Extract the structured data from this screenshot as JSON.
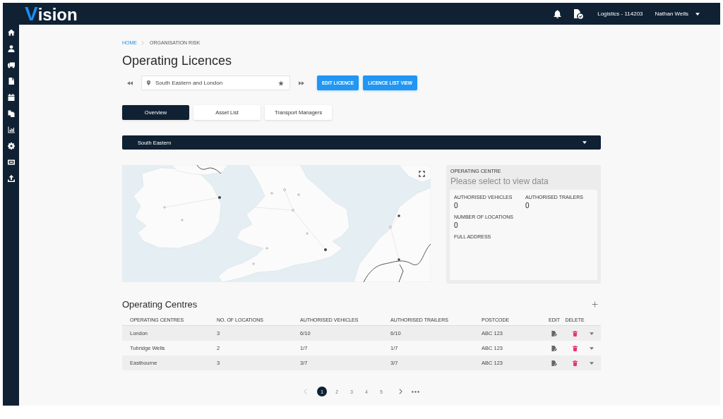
{
  "top_bar": {
    "logo": {
      "accent": "V",
      "rest": "ision"
    },
    "account": "Logistics - 114203",
    "user": "Nathan Wells"
  },
  "breadcrumb": [
    {
      "label": "HOME",
      "current": false
    },
    {
      "label": "ORGANISATION RISK",
      "current": true
    }
  ],
  "page_title": "Operating Licences",
  "licence_selector": {
    "value": "South Eastern and London"
  },
  "actions": [
    "EDIT LICENCE",
    "LICENCE LIST VIEW"
  ],
  "tabs": [
    {
      "label": "Overview",
      "selected": true
    },
    {
      "label": "Asset List",
      "selected": false
    },
    {
      "label": "Transport Managers",
      "selected": false
    }
  ],
  "region_dropdown": {
    "value": "South Eastern"
  },
  "operating_centre_panel": {
    "label": "OPERATING CENTRE",
    "message": "Please select to view data",
    "field_rows": [
      [
        {
          "label": "AUTHORISED VEHICLES",
          "value": "0"
        },
        {
          "label": "AUTHORISED TRAILERS",
          "value": "0"
        }
      ],
      [
        {
          "label": "NUMBER OF LOCATIONS",
          "value": "0"
        }
      ],
      [
        {
          "label": "FULL ADDRESS"
        }
      ]
    ]
  },
  "operating_centres": {
    "title": "Operating Centres",
    "columns": [
      "OPERATING CENTRES",
      "NO. OF LOCATIONS",
      "AUTHORISED VEHICLES",
      "AUTHORISED TRAILERS",
      "POSTCODE",
      "EDIT",
      "DELETE"
    ],
    "rows": [
      {
        "cells": [
          "London",
          "3",
          "6/10",
          "6/10",
          "ABC 123"
        ]
      },
      {
        "cells": [
          "Tubridge Wells",
          "2",
          "1/7",
          "1/7",
          "ABC 123"
        ]
      },
      {
        "cells": [
          "Eastbourne",
          "3",
          "3/7",
          "3/7",
          "ABC 123"
        ]
      }
    ]
  },
  "pagination": {
    "previous": {
      "disabled": true
    },
    "pages": [
      {
        "label": "1",
        "selected": true
      },
      {
        "label": "2",
        "selected": false
      },
      {
        "label": "3",
        "selected": false
      },
      {
        "label": "4",
        "selected": false
      },
      {
        "label": "5",
        "selected": false
      }
    ],
    "next": {
      "disabled": false
    }
  }
}
